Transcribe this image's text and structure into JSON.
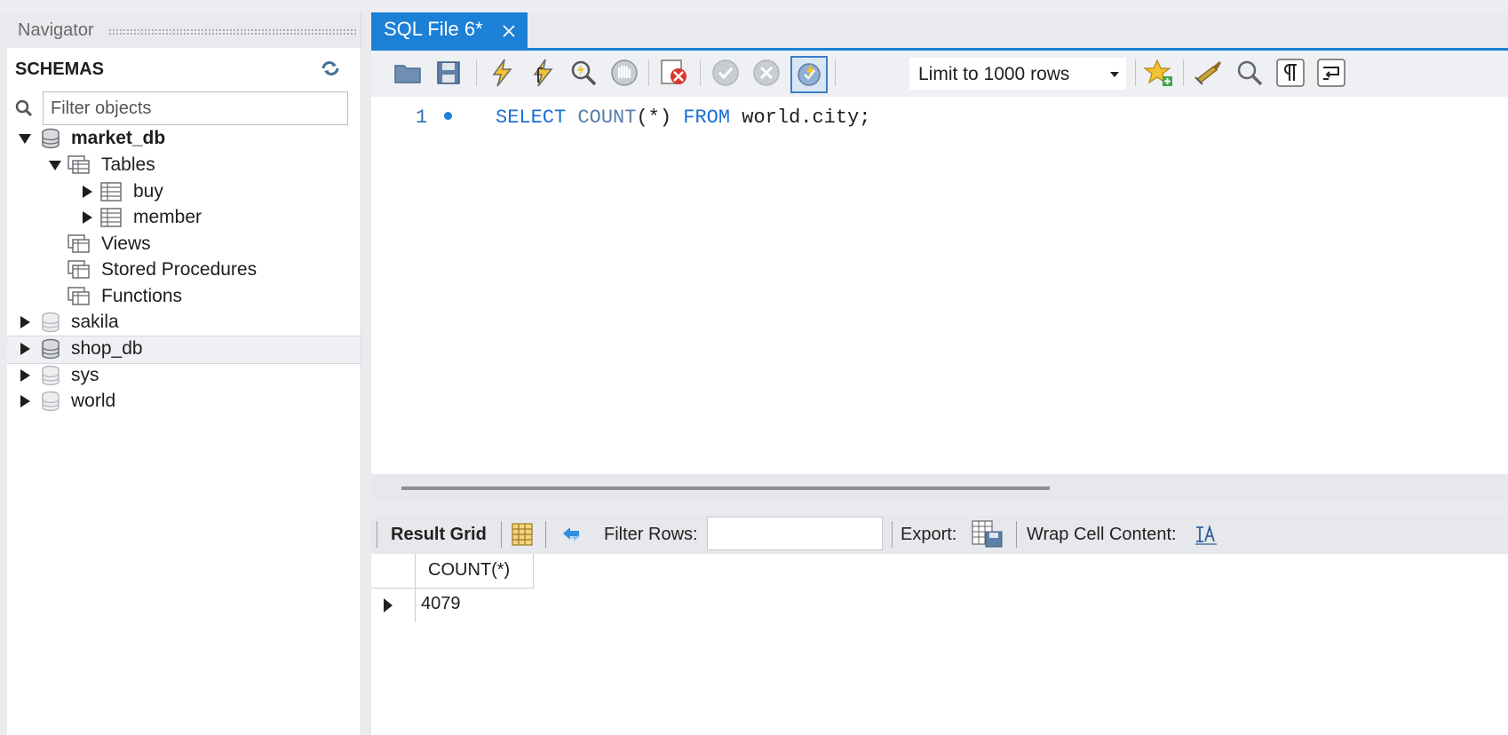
{
  "navigator": {
    "title": "Navigator",
    "schemas_label": "SCHEMAS",
    "filter_placeholder": "Filter objects",
    "tree": {
      "market_db": "market_db",
      "tables": "Tables",
      "buy": "buy",
      "member": "member",
      "views": "Views",
      "stored_procedures": "Stored Procedures",
      "functions": "Functions",
      "sakila": "sakila",
      "shop_db": "shop_db",
      "sys": "sys",
      "world": "world"
    }
  },
  "editor": {
    "tab_label": "SQL File 6*",
    "limit_label": "Limit to 1000 rows",
    "line_number": "1",
    "code": {
      "select": "SELECT",
      "count": "COUNT",
      "args": "(*)",
      "from": "FROM",
      "table": "world.city;"
    }
  },
  "results": {
    "result_grid_label": "Result Grid",
    "filter_rows_label": "Filter Rows:",
    "export_label": "Export:",
    "wrap_label": "Wrap Cell Content:",
    "column_header": "COUNT(*)",
    "cell_value": "4079"
  },
  "colors": {
    "accent": "#1b80d6",
    "keyword": "#1b6fd6"
  }
}
